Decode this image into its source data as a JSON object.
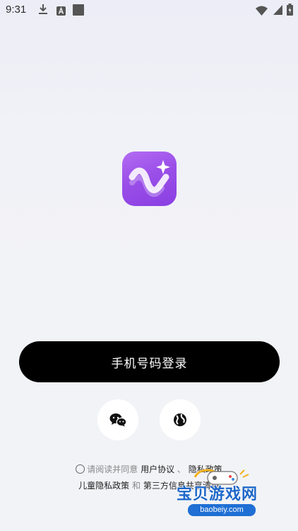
{
  "status_bar": {
    "time": "9:31",
    "icons": [
      "download-icon",
      "a-icon",
      "square-icon",
      "wifi-icon",
      "battery-icon"
    ]
  },
  "app": {
    "logo_icon": "wave-sparkle-icon",
    "logo_colors": [
      "#b46cf2",
      "#8a3fe2"
    ]
  },
  "login": {
    "phone_login_label": "手机号码登录"
  },
  "social_login": [
    {
      "icon": "wechat-icon"
    },
    {
      "icon": "globe-icon"
    }
  ],
  "agreement": {
    "prefix": "请阅读并同意",
    "user_agreement": "用户协议",
    "separator": "、",
    "privacy_policy": "隐私政策",
    "children_privacy": "儿童隐私政策",
    "and": "和",
    "third_party_sharing": "第三方信息共享清单"
  },
  "watermark": {
    "title": "宝贝游戏网",
    "domain": "baobeiy.com"
  }
}
